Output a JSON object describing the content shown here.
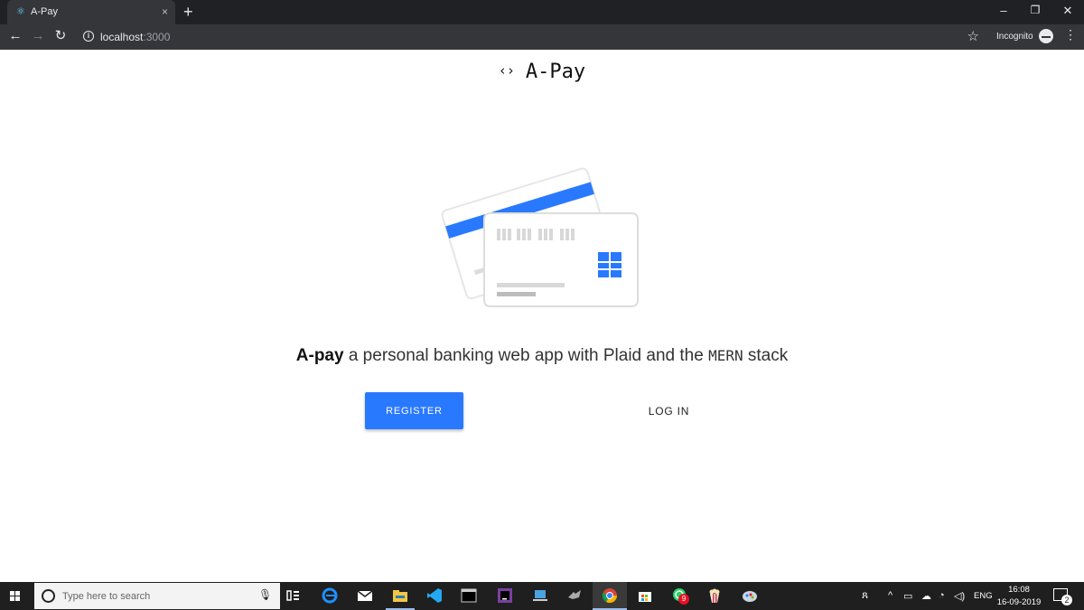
{
  "browser": {
    "tab_title": "A-Pay",
    "tab_close": "×",
    "new_tab": "+",
    "url_host": "localhost",
    "url_port": ":3000",
    "incognito_label": "Incognito"
  },
  "page": {
    "brand_icon": "‹›",
    "brand_name": "A-Pay",
    "tagline_bold": "A-pay",
    "tagline_text": " a personal banking web app with Plaid and the ",
    "tagline_mono": "MERN",
    "tagline_end": " stack",
    "register_label": "REGISTER",
    "login_label": "LOG IN",
    "accent_color": "#2979ff"
  },
  "taskbar": {
    "search_placeholder": "Type here to search",
    "language": "ENG",
    "time": "16:08",
    "date": "16-09-2019",
    "whatsapp_badge": "9",
    "notification_count": "2"
  }
}
